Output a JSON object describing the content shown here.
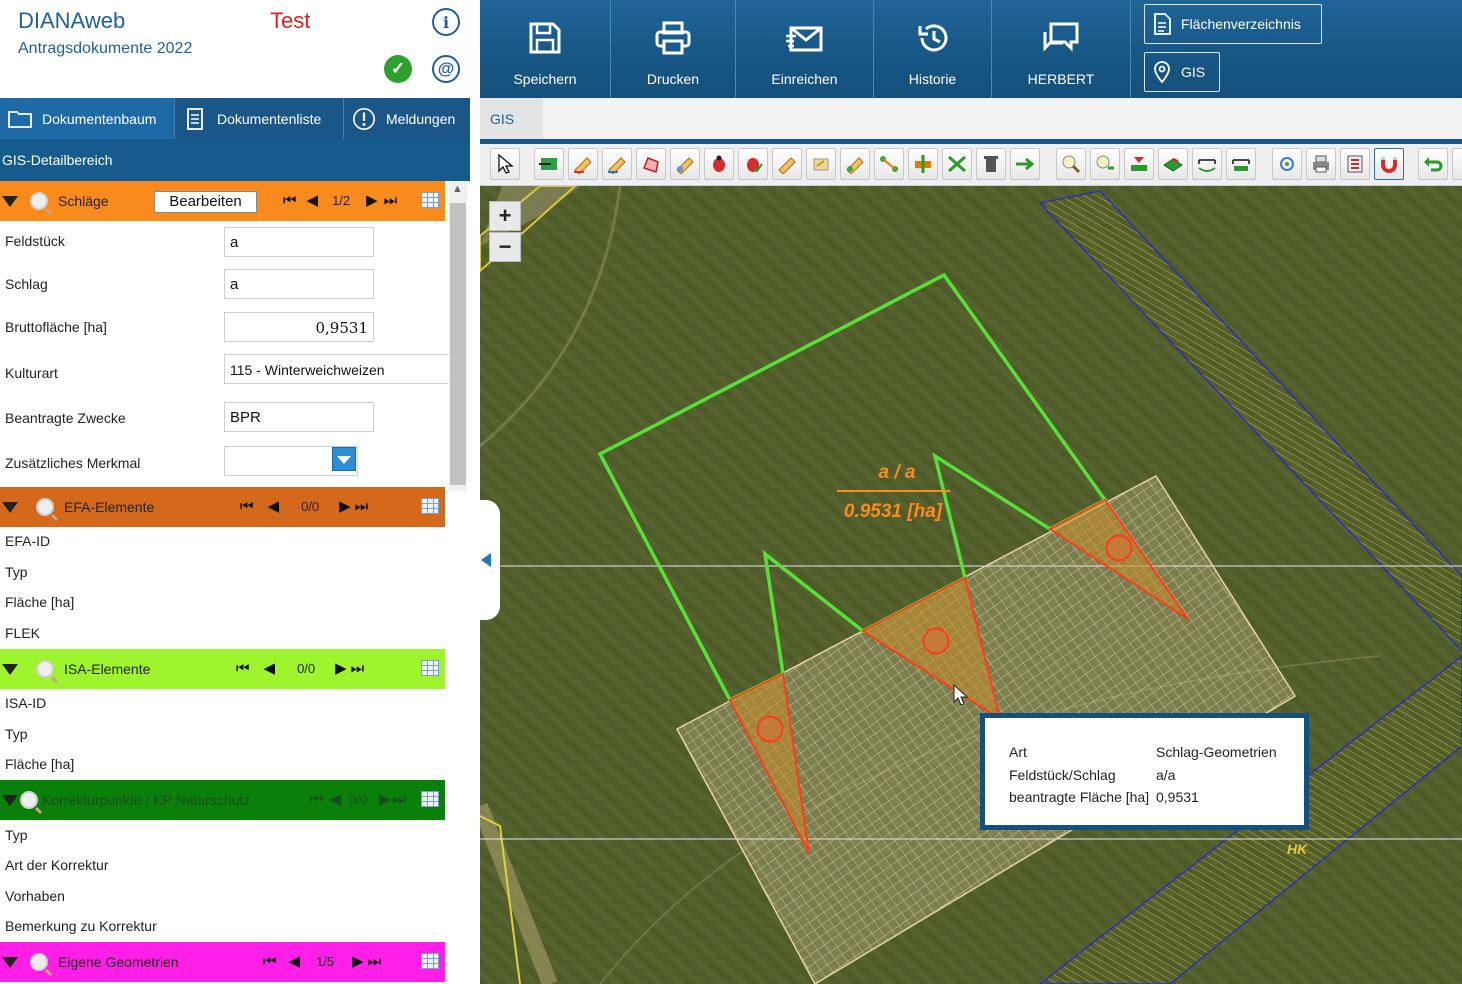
{
  "app": {
    "title": "DIANAweb",
    "subtitle": "Antragsdokumente 2022",
    "environment": "Test"
  },
  "tabs": [
    {
      "label": "Dokumentenbaum",
      "icon": "folder-icon",
      "active": true
    },
    {
      "label": "Dokumentenliste",
      "icon": "document-list-icon",
      "active": false
    },
    {
      "label": "Meldungen",
      "icon": "exclamation-icon",
      "active": false
    }
  ],
  "detail_title": "GIS-Detailbereich",
  "schlaege": {
    "title": "Schläge",
    "color": "#f98a1e",
    "edit_label": "Bearbeiten",
    "page": "1/2",
    "fields": [
      {
        "label": "Feldstück",
        "value": "a"
      },
      {
        "label": "Schlag",
        "value": "a"
      },
      {
        "label": "Bruttofläche [ha]",
        "value": "0,9531"
      },
      {
        "label": "Kulturart",
        "value": "115 - Winterweichweizen"
      },
      {
        "label": "Beantragte Zwecke",
        "value": "BPR"
      },
      {
        "label": "Zusätzliches Merkmal",
        "value": ""
      }
    ]
  },
  "efa": {
    "title": "EFA-Elemente",
    "color": "#d4691b",
    "page": "0/0",
    "rows": [
      "EFA-ID",
      "Typ",
      "Fläche [ha]",
      "FLEK"
    ]
  },
  "isa": {
    "title": "ISA-Elemente",
    "color": "#9ff52d",
    "page": "0/0",
    "rows": [
      "ISA-ID",
      "Typ",
      "Fläche [ha]"
    ]
  },
  "korrektur": {
    "title": "Korrekturpunkte / KP Naturschutz",
    "color": "#0a7f0a",
    "page": "0/0",
    "rows": [
      "Typ",
      "Art der Korrektur",
      "Vorhaben",
      "Bemerkung zu Korrektur"
    ]
  },
  "eigene": {
    "title": "Eigene Geometrien",
    "color": "#ff1fe6",
    "page": "1/5"
  },
  "toolbar": {
    "buttons": [
      {
        "label": "Speichern",
        "icon": "save-icon"
      },
      {
        "label": "Drucken",
        "icon": "printer-icon"
      },
      {
        "label": "Einreichen",
        "icon": "send-mail-icon"
      },
      {
        "label": "Historie",
        "icon": "history-icon"
      },
      {
        "label": "HERBERT",
        "icon": "chat-icon"
      }
    ],
    "side_buttons": [
      {
        "label": "Flächenverzeichnis",
        "icon": "document-icon"
      },
      {
        "label": "GIS",
        "icon": "map-pin-icon"
      }
    ]
  },
  "gis_tab": "GIS",
  "map": {
    "parcel_label": "a / a",
    "area_label": "0.9531 [ha]",
    "corner_label": "HK",
    "popup": [
      {
        "label": "Art",
        "value": "Schlag-Geometrien"
      },
      {
        "label": "Feldstück/Schlag",
        "value": "a/a"
      },
      {
        "label": "beantragte Fläche [ha]",
        "value": "0,9531"
      }
    ]
  }
}
